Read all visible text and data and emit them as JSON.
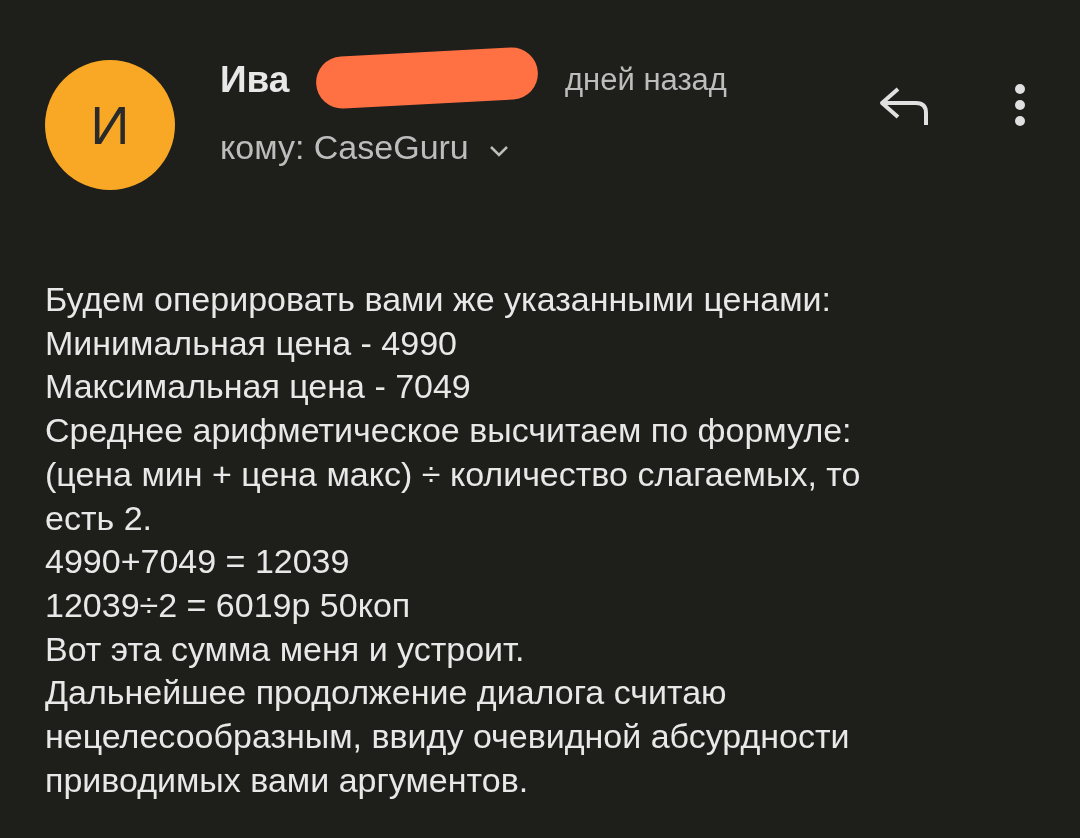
{
  "header": {
    "avatar_letter": "И",
    "sender": "Ива",
    "time": "дней назад",
    "recipient": "кому: CaseGuru",
    "redacted": true
  },
  "body": {
    "lines": [
      "Будем оперировать вами же указанными ценами:",
      "Минимальная цена - 4990",
      "Максимальная цена - 7049",
      "Среднее арифметическое высчитаем по формуле:",
      "(цена мин + цена макс) ÷ количество слагаемых, то",
      "есть 2.",
      "4990+7049 = 12039",
      "12039÷2 = 6019р 50коп",
      "Вот эта сумма меня и устроит.",
      "Дальнейшее продолжение диалога считаю",
      "нецелесообразным, ввиду очевидной абсурдности",
      "приводимых вами аргументов."
    ]
  }
}
